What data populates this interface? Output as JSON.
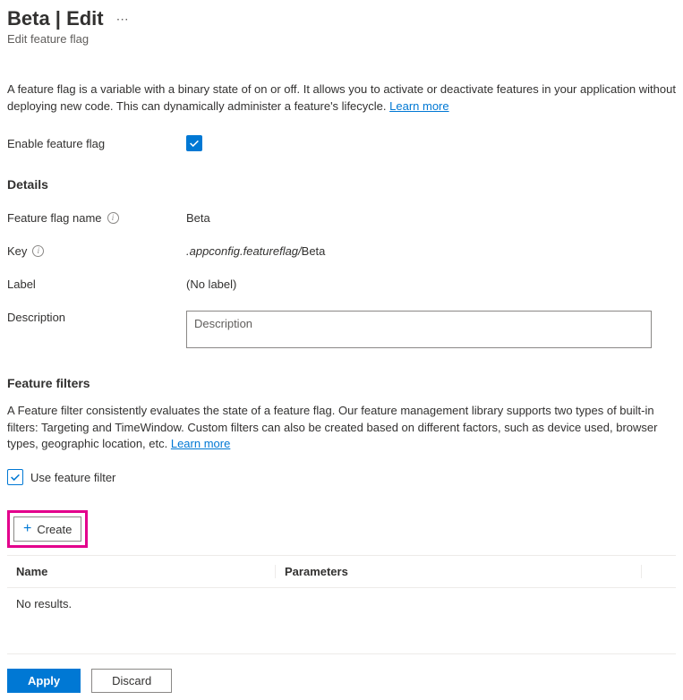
{
  "header": {
    "title": "Beta | Edit",
    "subtitle": "Edit feature flag"
  },
  "intro": {
    "text": "A feature flag is a variable with a binary state of on or off. It allows you to activate or deactivate features in your application without deploying new code. This can dynamically administer a feature's lifecycle. ",
    "learn_more": "Learn more"
  },
  "form": {
    "enable_label": "Enable feature flag",
    "enable_checked": true,
    "details_heading": "Details",
    "name_label": "Feature flag name",
    "name_value": "Beta",
    "key_label": "Key",
    "key_prefix": ".appconfig.featureflag/",
    "key_suffix": "Beta",
    "label_label": "Label",
    "label_value": "(No label)",
    "description_label": "Description",
    "description_placeholder": "Description",
    "description_value": ""
  },
  "filters": {
    "heading": "Feature filters",
    "description": "A Feature filter consistently evaluates the state of a feature flag. Our feature management library supports two types of built-in filters: Targeting and TimeWindow. Custom filters can also be created based on different factors, such as device used, browser types, geographic location, etc. ",
    "learn_more": "Learn more",
    "use_filter_label": "Use feature filter",
    "use_filter_checked": true,
    "create_label": "Create",
    "table": {
      "col_name": "Name",
      "col_params": "Parameters",
      "empty_text": "No results."
    }
  },
  "actions": {
    "apply": "Apply",
    "discard": "Discard"
  }
}
